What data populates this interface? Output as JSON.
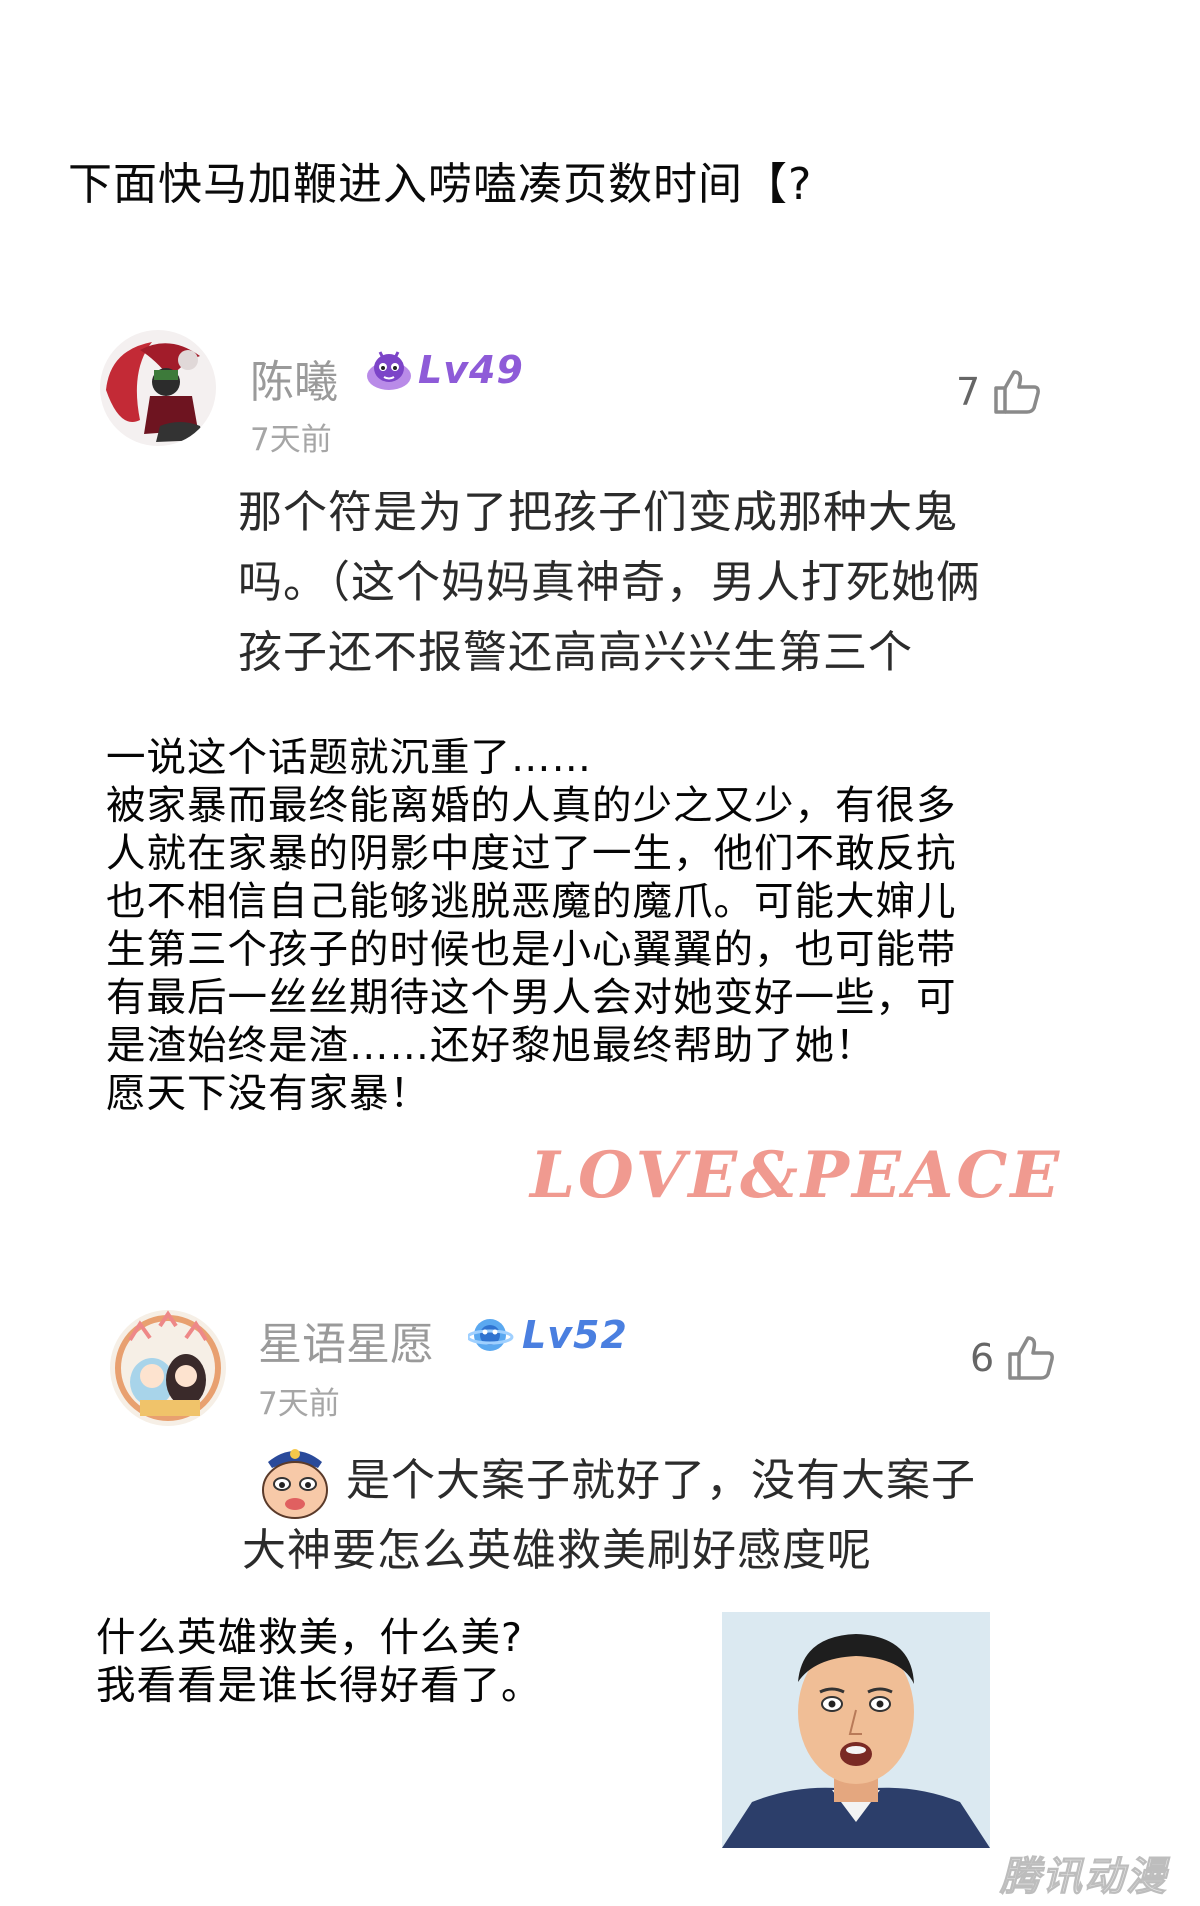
{
  "intro": "下面快马加鞭进入唠嗑凑页数时间【?",
  "comments": [
    {
      "username": "陈曦",
      "level": "Lv49",
      "level_color": "#8e5bd8",
      "time": "7天前",
      "likes": "7",
      "lines": [
        "那个符是为了把孩子们变成那种大鬼",
        "吗。（这个妈妈真神奇，男人打死她俩",
        "孩子还不报警还高高兴兴生第三个"
      ]
    },
    {
      "username": "星语星愿",
      "level": "Lv52",
      "level_color": "#4a7fe0",
      "time": "7天前",
      "likes": "6",
      "lines": [
        "是个大案子就好了，没有大案子",
        "大神要怎么英雄救美刷好感度呢"
      ]
    }
  ],
  "reply1": {
    "lines": [
      "一说这个话题就沉重了……",
      "被家暴而最终能离婚的人真的少之又少，有很多",
      "人就在家暴的阴影中度过了一生，他们不敢反抗",
      "也不相信自己能够逃脱恶魔的魔爪。可能大婶儿",
      "生第三个孩子的时候也是小心翼翼的，也可能带",
      "有最后一丝丝期待这个男人会对她变好一些，可",
      "是渣始终是渣……还好黎旭最终帮助了她！",
      "愿天下没有家暴！"
    ],
    "signature": "LOVE&PEACE"
  },
  "reply2": {
    "lines": [
      "什么英雄救美，什么美?",
      "我看看是谁长得好看了。"
    ]
  },
  "watermark": "腾讯动漫",
  "colors": {
    "username": "#9a9a9a",
    "time": "#a6a6a6",
    "signature": "#f09a90"
  }
}
